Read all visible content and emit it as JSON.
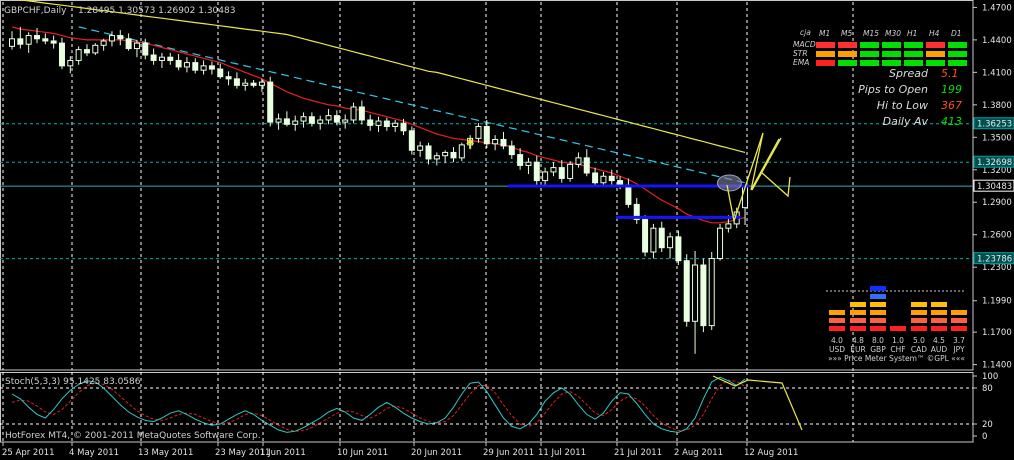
{
  "chart_data": {
    "type": "candlestick",
    "symbol_label": "GBPCHF,Daily",
    "ohlc_label": "1.28495 1.30573 1.26902 1.30483",
    "y_ticks": [
      "1.4700",
      "1.4400",
      "1.4100",
      "1.3800",
      "1.3500",
      "1.3200",
      "1.2900",
      "1.2600",
      "1.2300",
      "1.1990",
      "1.1700",
      "1.1400"
    ],
    "ylim": [
      1.135,
      1.475
    ],
    "price_tags": [
      {
        "value": 1.36253,
        "label": "1.36253",
        "color": "#00c8c8"
      },
      {
        "value": 1.32698,
        "label": "1.32698",
        "color": "#00c8c8"
      },
      {
        "value": 1.30483,
        "label": "1.30483",
        "color": "#ffffff"
      },
      {
        "value": 1.23786,
        "label": "1.23786",
        "color": "#00c8c8"
      }
    ],
    "x_labels": [
      "25 Apr 2011",
      "4 May 2011",
      "13 May 2011",
      "23 May 2011",
      "1 Jun 2011",
      "10 Jun 2011",
      "20 Jun 2011",
      "29 Jun 2011",
      "11 Jul 2011",
      "21 Jul 2011",
      "2 Aug 2011",
      "12 Aug 2011"
    ],
    "candles": [
      [
        1.434,
        1.448,
        1.431,
        1.441
      ],
      [
        1.441,
        1.452,
        1.432,
        1.436
      ],
      [
        1.436,
        1.447,
        1.428,
        1.444
      ],
      [
        1.444,
        1.451,
        1.437,
        1.441
      ],
      [
        1.441,
        1.446,
        1.436,
        1.439
      ],
      [
        1.439,
        1.444,
        1.432,
        1.437
      ],
      [
        1.437,
        1.442,
        1.413,
        1.416
      ],
      [
        1.416,
        1.425,
        1.409,
        1.421
      ],
      [
        1.421,
        1.434,
        1.417,
        1.431
      ],
      [
        1.431,
        1.436,
        1.425,
        1.428
      ],
      [
        1.428,
        1.437,
        1.426,
        1.435
      ],
      [
        1.435,
        1.441,
        1.43,
        1.439
      ],
      [
        1.439,
        1.448,
        1.434,
        1.444
      ],
      [
        1.444,
        1.449,
        1.435,
        1.441
      ],
      [
        1.441,
        1.446,
        1.43,
        1.432
      ],
      [
        1.432,
        1.44,
        1.424,
        1.437
      ],
      [
        1.437,
        1.441,
        1.422,
        1.426
      ],
      [
        1.426,
        1.432,
        1.417,
        1.421
      ],
      [
        1.421,
        1.428,
        1.414,
        1.424
      ],
      [
        1.424,
        1.428,
        1.417,
        1.421
      ],
      [
        1.421,
        1.427,
        1.412,
        1.415
      ],
      [
        1.415,
        1.424,
        1.41,
        1.419
      ],
      [
        1.419,
        1.423,
        1.409,
        1.412
      ],
      [
        1.412,
        1.421,
        1.408,
        1.416
      ],
      [
        1.416,
        1.42,
        1.408,
        1.413
      ],
      [
        1.413,
        1.418,
        1.404,
        1.406
      ],
      [
        1.406,
        1.411,
        1.398,
        1.404
      ],
      [
        1.404,
        1.41,
        1.395,
        1.398
      ],
      [
        1.398,
        1.404,
        1.393,
        1.4
      ],
      [
        1.4,
        1.403,
        1.396,
        1.398
      ],
      [
        1.398,
        1.404,
        1.392,
        1.401
      ],
      [
        1.401,
        1.406,
        1.36,
        1.364
      ],
      [
        1.364,
        1.372,
        1.357,
        1.367
      ],
      [
        1.367,
        1.374,
        1.36,
        1.362
      ],
      [
        1.362,
        1.37,
        1.356,
        1.365
      ],
      [
        1.365,
        1.373,
        1.359,
        1.369
      ],
      [
        1.369,
        1.373,
        1.36,
        1.363
      ],
      [
        1.363,
        1.37,
        1.357,
        1.366
      ],
      [
        1.366,
        1.376,
        1.362,
        1.37
      ],
      [
        1.37,
        1.375,
        1.361,
        1.364
      ],
      [
        1.364,
        1.371,
        1.358,
        1.366
      ],
      [
        1.366,
        1.382,
        1.363,
        1.378
      ],
      [
        1.378,
        1.384,
        1.362,
        1.366
      ],
      [
        1.366,
        1.371,
        1.356,
        1.361
      ],
      [
        1.361,
        1.369,
        1.355,
        1.365
      ],
      [
        1.365,
        1.368,
        1.356,
        1.36
      ],
      [
        1.36,
        1.366,
        1.355,
        1.363
      ],
      [
        1.363,
        1.367,
        1.352,
        1.356
      ],
      [
        1.356,
        1.36,
        1.334,
        1.338
      ],
      [
        1.338,
        1.346,
        1.332,
        1.342
      ],
      [
        1.342,
        1.345,
        1.325,
        1.33
      ],
      [
        1.33,
        1.336,
        1.324,
        1.333
      ],
      [
        1.333,
        1.338,
        1.326,
        1.336
      ],
      [
        1.336,
        1.341,
        1.327,
        1.331
      ],
      [
        1.331,
        1.345,
        1.328,
        1.343
      ],
      [
        1.343,
        1.352,
        1.339,
        1.349
      ],
      [
        1.349,
        1.363,
        1.345,
        1.36
      ],
      [
        1.36,
        1.366,
        1.34,
        1.344
      ],
      [
        1.344,
        1.352,
        1.338,
        1.348
      ],
      [
        1.348,
        1.355,
        1.339,
        1.342
      ],
      [
        1.342,
        1.347,
        1.33,
        1.334
      ],
      [
        1.334,
        1.34,
        1.32,
        1.324
      ],
      [
        1.324,
        1.331,
        1.316,
        1.327
      ],
      [
        1.327,
        1.333,
        1.306,
        1.31
      ],
      [
        1.31,
        1.322,
        1.305,
        1.318
      ],
      [
        1.318,
        1.327,
        1.314,
        1.322
      ],
      [
        1.322,
        1.329,
        1.308,
        1.312
      ],
      [
        1.312,
        1.328,
        1.309,
        1.325
      ],
      [
        1.325,
        1.336,
        1.322,
        1.331
      ],
      [
        1.331,
        1.339,
        1.314,
        1.317
      ],
      [
        1.317,
        1.322,
        1.304,
        1.308
      ],
      [
        1.308,
        1.318,
        1.304,
        1.314
      ],
      [
        1.314,
        1.32,
        1.306,
        1.31
      ],
      [
        1.31,
        1.314,
        1.302,
        1.306
      ],
      [
        1.306,
        1.312,
        1.285,
        1.288
      ],
      [
        1.288,
        1.294,
        1.27,
        1.274
      ],
      [
        1.274,
        1.278,
        1.24,
        1.244
      ],
      [
        1.244,
        1.27,
        1.238,
        1.266
      ],
      [
        1.266,
        1.272,
        1.244,
        1.248
      ],
      [
        1.248,
        1.262,
        1.238,
        1.258
      ],
      [
        1.258,
        1.264,
        1.232,
        1.236
      ],
      [
        1.236,
        1.242,
        1.175,
        1.18
      ],
      [
        1.18,
        1.245,
        1.15,
        1.232
      ],
      [
        1.232,
        1.238,
        1.17,
        1.176
      ],
      [
        1.176,
        1.244,
        1.172,
        1.238
      ],
      [
        1.238,
        1.27,
        1.236,
        1.266
      ],
      [
        1.266,
        1.278,
        1.262,
        1.27
      ],
      [
        1.27,
        1.285,
        1.266,
        1.281
      ],
      [
        1.285,
        1.306,
        1.269,
        1.305
      ]
    ],
    "ma_red": [
      1.452,
      1.45,
      1.449,
      1.448,
      1.447,
      1.446,
      1.444,
      1.442,
      1.441,
      1.44,
      1.44,
      1.44,
      1.44,
      1.44,
      1.439,
      1.438,
      1.437,
      1.435,
      1.433,
      1.431,
      1.429,
      1.427,
      1.425,
      1.423,
      1.421,
      1.419,
      1.416,
      1.413,
      1.41,
      1.407,
      1.404,
      1.4,
      1.396,
      1.392,
      1.389,
      1.386,
      1.384,
      1.382,
      1.38,
      1.379,
      1.377,
      1.376,
      1.375,
      1.373,
      1.371,
      1.369,
      1.367,
      1.365,
      1.362,
      1.359,
      1.356,
      1.353,
      1.351,
      1.349,
      1.348,
      1.347,
      1.346,
      1.345,
      1.344,
      1.343,
      1.341,
      1.338,
      1.336,
      1.333,
      1.331,
      1.329,
      1.327,
      1.326,
      1.325,
      1.323,
      1.321,
      1.319,
      1.317,
      1.314,
      1.311,
      1.307,
      1.302,
      1.297,
      1.292,
      1.288,
      1.284,
      1.279,
      1.276,
      1.273,
      1.271,
      1.271,
      1.272,
      1.274,
      1.276
    ],
    "ma_yellow": [
      1.478,
      1.477,
      1.476,
      1.475,
      1.474,
      1.473,
      1.472,
      1.471,
      1.47,
      1.469,
      1.468,
      1.467,
      1.466,
      1.465,
      1.464,
      1.463,
      1.462,
      1.461,
      1.46,
      1.459,
      1.458,
      1.457,
      1.456,
      1.455,
      1.454,
      1.453,
      1.452,
      1.451,
      1.45,
      1.449,
      1.448,
      1.447,
      1.446,
      1.445,
      1.443,
      1.441,
      1.439,
      1.437,
      1.435,
      1.433,
      1.431,
      1.429,
      1.427,
      1.425,
      1.423,
      1.421,
      1.419,
      1.417,
      1.415,
      1.413,
      1.411,
      1.41,
      1.408,
      1.406,
      1.404,
      1.402,
      1.4,
      1.398,
      1.396,
      1.394,
      1.392,
      1.39,
      1.388,
      1.386,
      1.384,
      1.382,
      1.38,
      1.378,
      1.376,
      1.374,
      1.372,
      1.37,
      1.368,
      1.366,
      1.364,
      1.362,
      1.36,
      1.358,
      1.356,
      1.354,
      1.352,
      1.35,
      1.348,
      1.346,
      1.344,
      1.342,
      1.34,
      1.338,
      1.336
    ],
    "indicator": {
      "label": "Stoch(5,3,3) 95.1425 83.0586",
      "y_ticks": [
        "100",
        "80",
        "20",
        "0"
      ],
      "ylim": [
        0,
        100
      ],
      "k": [
        70,
        62,
        48,
        36,
        30,
        44,
        62,
        76,
        86,
        92,
        90,
        80,
        66,
        52,
        40,
        32,
        26,
        24,
        30,
        38,
        42,
        36,
        28,
        22,
        18,
        20,
        28,
        36,
        42,
        36,
        26,
        18,
        10,
        6,
        8,
        14,
        22,
        30,
        40,
        46,
        40,
        30,
        26,
        36,
        48,
        56,
        48,
        38,
        30,
        24,
        20,
        22,
        30,
        48,
        70,
        88,
        90,
        74,
        52,
        30,
        16,
        12,
        20,
        36,
        58,
        72,
        80,
        70,
        52,
        36,
        28,
        38,
        58,
        72,
        70,
        54,
        36,
        20,
        12,
        8,
        6,
        12,
        30,
        62,
        90,
        98,
        92,
        84,
        95
      ],
      "d": [
        56,
        60,
        58,
        50,
        40,
        36,
        44,
        58,
        72,
        84,
        88,
        86,
        78,
        66,
        54,
        42,
        34,
        28,
        26,
        30,
        36,
        38,
        36,
        30,
        24,
        20,
        22,
        28,
        36,
        38,
        34,
        26,
        18,
        11,
        8,
        9,
        14,
        22,
        30,
        38,
        42,
        40,
        34,
        30,
        36,
        46,
        50,
        46,
        38,
        30,
        24,
        22,
        24,
        34,
        52,
        70,
        84,
        84,
        72,
        52,
        34,
        20,
        16,
        22,
        38,
        56,
        70,
        74,
        66,
        52,
        38,
        34,
        44,
        58,
        66,
        62,
        50,
        34,
        22,
        14,
        9,
        10,
        18,
        36,
        62,
        84,
        93,
        91,
        83
      ],
      "projection_k": [
        [
          713,
          376
        ],
        [
          735,
          386
        ],
        [
          748,
          380
        ],
        [
          782,
          383
        ],
        [
          802,
          430
        ]
      ]
    },
    "annotations": {
      "channel_top_dash": [
        [
          1.452,
          8
        ],
        [
          1.308,
          88
        ]
      ],
      "blue_lines": [
        {
          "value": 1.305,
          "from": 60,
          "to": 88
        },
        {
          "value": 1.276,
          "from": 73,
          "to": 87
        }
      ],
      "ellipse": {
        "index": 86,
        "value": 1.3078
      },
      "arrow_marker": {
        "index": 55,
        "value": 1.345
      },
      "projection_price": [
        [
          727,
          185
        ],
        [
          734,
          221
        ],
        [
          763,
          133
        ],
        [
          751,
          190
        ],
        [
          779,
          139
        ],
        [
          761,
          172
        ],
        [
          788,
          196
        ],
        [
          790,
          177
        ]
      ]
    },
    "panel_header": {
      "row0": "cja",
      "cols": [
        "M1",
        "M5",
        "M15",
        "M30",
        "H1",
        "H4",
        "D1"
      ],
      "rows": [
        "MACD",
        "STR",
        "EMA"
      ]
    },
    "info": [
      {
        "label": "Spread",
        "value": "5.1",
        "color": "#ff5020"
      },
      {
        "label": "Pips to Open",
        "value": "199",
        "color": "#00e000"
      },
      {
        "label": "Hi to Low",
        "value": "367",
        "color": "#ff5020"
      },
      {
        "label": "Daily Av",
        "value": "413",
        "color": "#00e000"
      }
    ],
    "currencies": [
      {
        "code": "USD",
        "value": "4.0"
      },
      {
        "code": "EUR",
        "value": "4.8"
      },
      {
        "code": "GBP",
        "value": "8.0"
      },
      {
        "code": "CHF",
        "value": "1.0"
      },
      {
        "code": "CAD",
        "value": "5.0"
      },
      {
        "code": "AUD",
        "value": "4.5"
      },
      {
        "code": "JPY",
        "value": "3.7"
      }
    ],
    "meter_footer": "»»» Price Meter System™ ©GPL «««",
    "copyright": "HotForex MT4, © 2001-2011 MetaQuotes Software Corp."
  }
}
